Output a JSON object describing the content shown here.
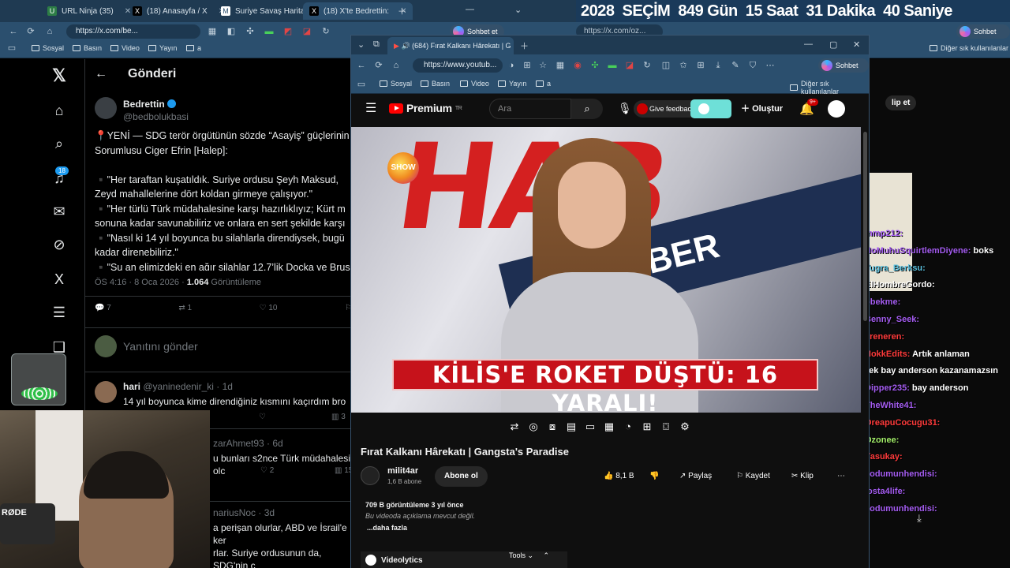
{
  "background_browser": {
    "tabs": [
      {
        "title": "URL Ninja (35)",
        "icon": "url-ninja-icon"
      },
      {
        "title": "(18) Anasayfa / X",
        "icon": "x-logo-icon"
      },
      {
        "title": "Suriye Savaş Haritası",
        "icon": "map-icon"
      },
      {
        "title": "(18) X'te Bedrettin:",
        "icon": "x-logo-icon"
      }
    ],
    "url": "https://x.com/be...",
    "url_right": "https://x.com/oz...",
    "sohbet_label": "Sohbet et",
    "bookmarks": [
      "Sosyal",
      "Basın",
      "Video",
      "Yayın",
      "a"
    ],
    "other_bookmarks": "Diğer sık kullanılanlar"
  },
  "election_banner": {
    "year": "2028",
    "label": "SEÇİM",
    "days": "849 Gün",
    "hours": "15 Saat",
    "minutes": "31 Dakika",
    "seconds": "40 Saniye"
  },
  "x_page": {
    "header_title": "Gönderi",
    "notification_count": "18",
    "post": {
      "author_name": "Bedrettin",
      "author_handle": "@bedbolukbasi",
      "text": "📍YENİ — SDG terör örgütünün sözde “Asayiş” güçlerinin\nSorumlusu Ciger Efrin [Halep]:\n\n▪️\"Her taraftan kuşatıldık. Suriye ordusu Şeyh Maksud,\nZeyd mahallelerine dört koldan girmeye çalışıyor.\"\n▪️\"Her türlü Türk müdahalesine karşı hazırlıklıyız; Kürt m\nsonuna kadar savunabiliriz ve onlara en sert şekilde karşı\n▪️\"Nasıl ki 14 yıl boyunca bu silahlarla direndiysek, bugü\nkadar direnebiliriz.\"\n▪️\"Şu an elimizdeki en ağır silahlar 12.7’lik Doçka ve Brus",
      "time": "ÖS 4:16 · 8 Oca 2026 ·",
      "views": "1.064",
      "views_label": "Görüntüleme",
      "replies": "7",
      "reposts": "1",
      "likes": "10"
    },
    "reply_placeholder": "Yanıtını gönder",
    "replies": [
      {
        "name": "hari",
        "handle": "@yaninedenir_ki · 1d",
        "text": "14 yıl boyunca kime direndiğiniz kısmını kaçırdım bro",
        "views": "3"
      },
      {
        "name": "",
        "handle": "zarAhmet93 · 6d",
        "text": "u bunları s2nce Türk müdahalesi olc",
        "likes": "2",
        "views": "15"
      },
      {
        "name": "",
        "handle": "nariusNoc · 3d",
        "text": "a perişan olurlar, ABD ve İsrail'e ker\nrlar. Suriye ordusunun da, SDG'nin c\ndar komik bir durum yok."
      }
    ]
  },
  "youtube_window": {
    "tab_title": "(684) Fırat Kalkanı Hârekatı | G",
    "url": "https://www.youtub...",
    "sohbet_label": "Sohbet et",
    "bookmarks": [
      "Sosyal",
      "Basın",
      "Video",
      "Yayın",
      "a"
    ],
    "other_bookmarks": "Diğer sık kullanılanlar",
    "logo_text": "Premium",
    "logo_sup": "TR",
    "search_placeholder": "Ara",
    "feedback_label": "Give feedback",
    "create_label": "Oluştur",
    "notification_badge": "9+",
    "video": {
      "headline_bg": "HAB",
      "band_text": "HABER",
      "channel_logo": "SHOW",
      "lower_third": "KİLİS'E ROKET DÜŞTÜ: 16 YARALI!"
    },
    "title": "Fırat Kalkanı Hârekatı | Gangsta's Paradise",
    "channel": {
      "name": "milit4ar",
      "subscribers": "1,6 B abone",
      "subscribe_label": "Abone ol"
    },
    "actions": {
      "likes": "8,1 B",
      "share": "Paylaş",
      "save": "Kaydet",
      "clip": "Klip"
    },
    "description": {
      "stats": "709 B görüntüleme  3 yıl önce",
      "text": "Bu videoda açıklama mevcut değil.",
      "more": "...daha fazla"
    },
    "videolytics_label": "Videolytics",
    "tools_label": "Tools"
  },
  "right_panel": {
    "klip_label": "lip et",
    "chat": [
      {
        "user": "mmp212:",
        "msg": "",
        "color": "#a45cf0"
      },
      {
        "user": "NoMuhuSquirtlemDiyene:",
        "msg": "boks",
        "color": "#a45cf0"
      },
      {
        "user": "Tugra_Berksu:",
        "msg": "",
        "color": "#5bc0de"
      },
      {
        "user": "ElHombreGordo:",
        "msg": "",
        "color": "#ffffff"
      },
      {
        "user": "obekme:",
        "msg": "",
        "color": "#a45cf0"
      },
      {
        "user": "Benny_Seek:",
        "msg": "",
        "color": "#a45cf0"
      },
      {
        "user": "ereneren:",
        "msg": "",
        "color": "#ff3b3b"
      },
      {
        "user": "NokkEdits:",
        "msg": "Artık anlaman",
        "color": "#ff3b3b"
      },
      {
        "user": "",
        "msg": "gerek bay anderson kazanamazsın",
        "color": "#ffffff"
      },
      {
        "user": "Dipper235:",
        "msg": "bay anderson",
        "color": "#a45cf0"
      },
      {
        "user": "TheWhite41:",
        "msg": "",
        "color": "#a45cf0"
      },
      {
        "user": "OreapuCocugu31:",
        "msg": "",
        "color": "#ff3b3b"
      },
      {
        "user": "Ozonee:",
        "msg": "",
        "color": "#a4f06a"
      },
      {
        "user": "Yasukay:",
        "msg": "",
        "color": "#ff3b3b"
      },
      {
        "user": "kodumunhendisi:",
        "msg": "",
        "color": "#a45cf0"
      },
      {
        "user": "losta4life:",
        "msg": "",
        "color": "#a45cf0"
      },
      {
        "user": "kodumunhendisi:",
        "msg": "",
        "color": "#a45cf0"
      }
    ]
  },
  "colors": {
    "yt_red": "#ff0000",
    "x_blue": "#1d9bf0",
    "chrome_blue": "#2b4f6e"
  }
}
